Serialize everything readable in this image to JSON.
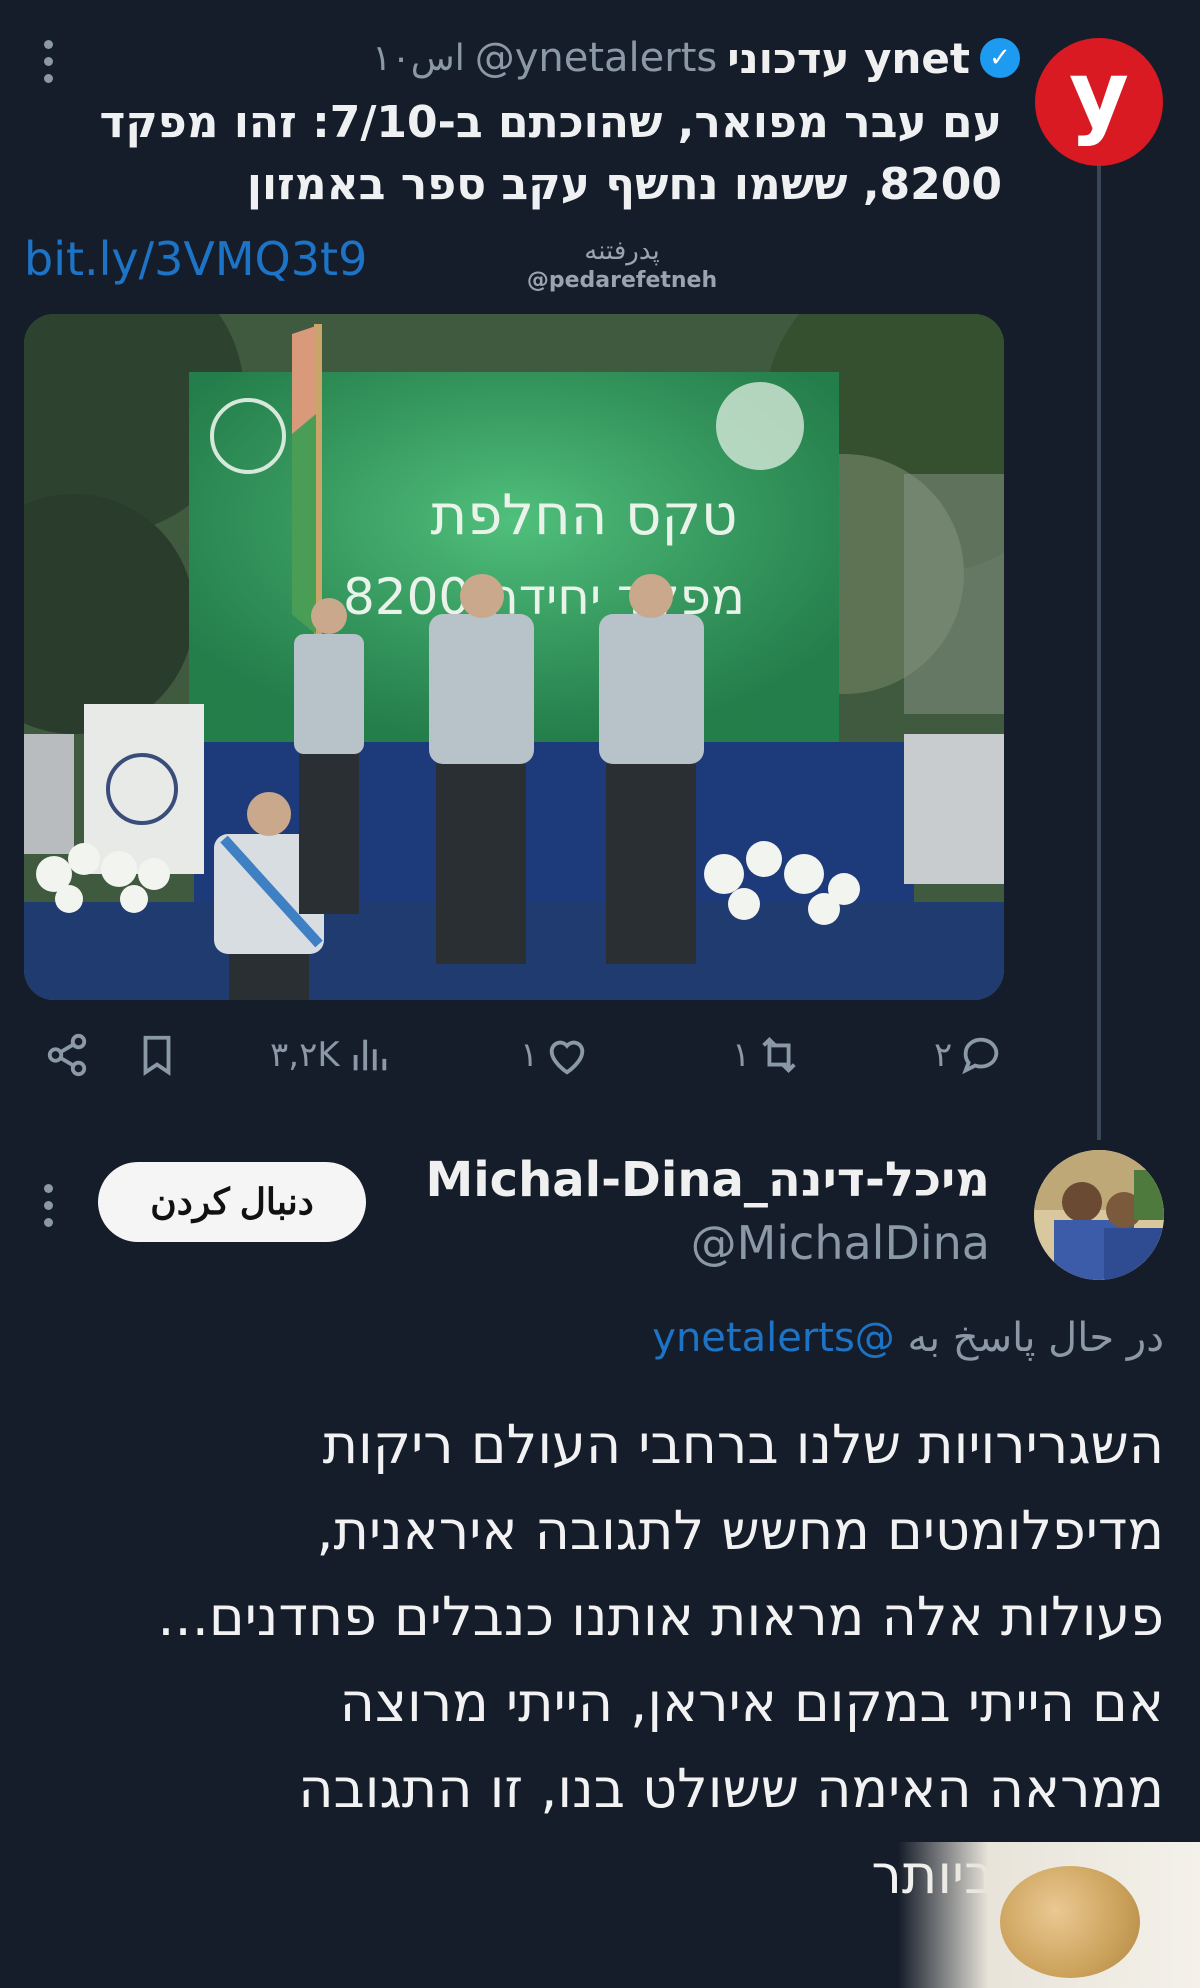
{
  "tweet1": {
    "avatar_letter": "y",
    "author_name": "עדכוני ynet",
    "handle": "@ynetalerts",
    "time": "۱۰اس",
    "text_line1": "עם עבר מפואר, שהוכתם ב-7/10: זהו מפקד",
    "text_line2": "8200, ששמו נחשף עקב ספר באמזון",
    "link": "bit.ly/3VMQ3t9",
    "watermark_fa": "پدرفتنه",
    "watermark_handle": "@pedarefetneh",
    "image_banner_line1": "טקס החלפת",
    "image_banner_line2": "מפקד יחידה 8200",
    "stats": {
      "views": "۳,۲K",
      "likes": "۱",
      "retweets": "۱",
      "replies": "۲"
    }
  },
  "tweet2": {
    "author_name": "Michal-Dina_מיכל-דינה",
    "handle": "@MichalDina",
    "follow_label": "دنبال کردن",
    "reply_prefix": "در حال پاسخ به",
    "reply_mention": "@ynetalerts",
    "text_lines": [
      "השגרירויות שלנו ברחבי העולם ריקות",
      "מדיפלומטים מחשש לתגובה איראנית,",
      "פעולות אלה מראות אותנו כנבלים פחדנים...",
      "אם הייתי במקום איראן, הייתי מרוצה",
      "ממראה האימה ששולט בנו, זו התגובה",
      "הטובה ביותר"
    ]
  },
  "colors": {
    "background": "#151d2a",
    "link": "#1d74c6",
    "verified": "#1d9bf0",
    "ynet_red": "#d91a22",
    "muted": "#8b98a5"
  },
  "icons": [
    "more-icon",
    "verified-icon",
    "share-icon",
    "bookmark-icon",
    "views-icon",
    "like-icon",
    "retweet-icon",
    "reply-icon"
  ]
}
